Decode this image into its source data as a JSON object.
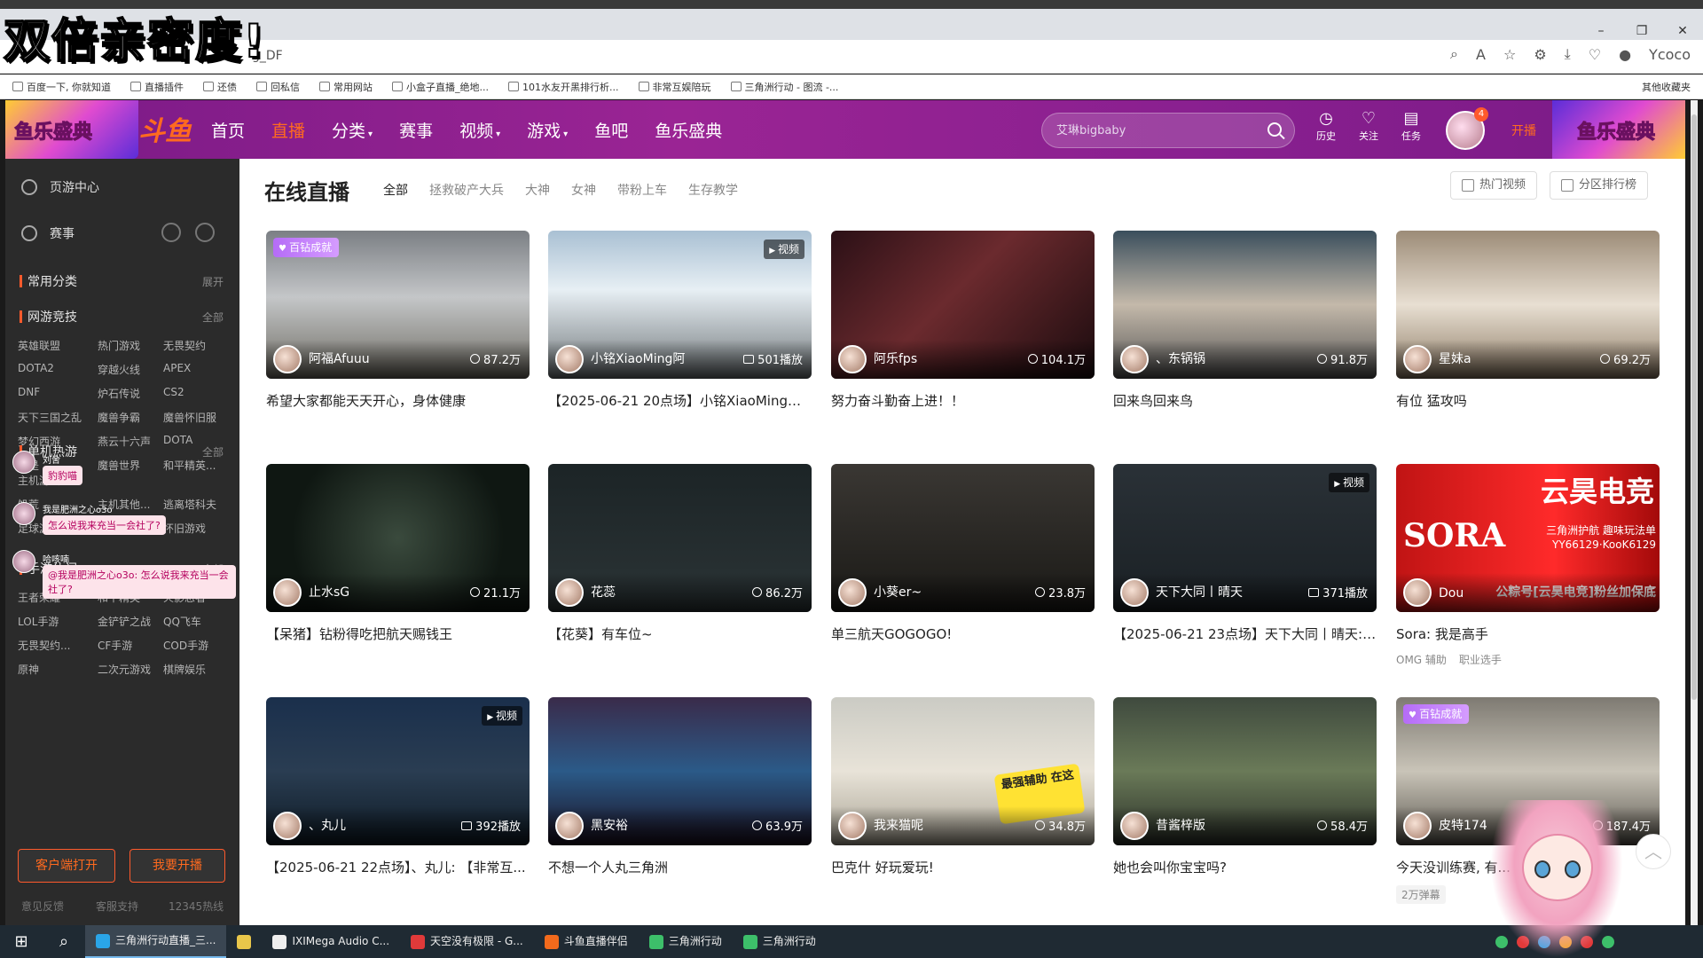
{
  "overlay_title": "双倍亲密度!",
  "browser": {
    "url": "g_DF",
    "bookmarks": [
      "百度一下, 你就知道",
      "直播插件",
      "还债",
      "回私信",
      "常用网站",
      "小盒子直播_绝地...",
      "101水友开黑排行析...",
      "非常互娱陪玩",
      "三角洲行动 - 图流 -..."
    ],
    "other_bookmarks": "其他收藏夹",
    "profile_label": "Ycoco"
  },
  "header": {
    "promo_left": "鱼乐盛典",
    "logo": "斗鱼",
    "nav": [
      {
        "label": "首页",
        "active": false,
        "caret": false
      },
      {
        "label": "直播",
        "active": true,
        "caret": false
      },
      {
        "label": "分类",
        "active": false,
        "caret": true
      },
      {
        "label": "赛事",
        "active": false,
        "caret": false
      },
      {
        "label": "视频",
        "active": false,
        "caret": true
      },
      {
        "label": "游戏",
        "active": false,
        "caret": true
      },
      {
        "label": "鱼吧",
        "active": false,
        "caret": false
      },
      {
        "label": "鱼乐盛典",
        "active": false,
        "caret": false
      }
    ],
    "search_placeholder": "艾琳bigbaby",
    "tools": [
      {
        "label": "历史",
        "icon": "clock-icon"
      },
      {
        "label": "关注",
        "icon": "heart-icon"
      },
      {
        "label": "任务",
        "icon": "task-icon"
      }
    ],
    "avatar_badge": "4",
    "kaibo": "开播",
    "promo_right": "鱼乐盛典"
  },
  "sidebar": {
    "top_items": [
      "页游中心",
      "赛事"
    ],
    "common_label": "常用分类",
    "common_expand": "展开",
    "groups": [
      {
        "label": "网游竞技",
        "expand": "全部",
        "rows": [
          [
            "英雄联盟",
            "热门游戏",
            "无畏契约"
          ],
          [
            "DOTA2",
            "穿越火线",
            "APEX"
          ],
          [
            "DNF",
            "炉石传说",
            "CS2"
          ],
          [
            "天下三国之乱",
            "魔兽争霸",
            "魔兽怀旧服"
          ],
          [
            "梦幻西游",
            "燕云十六声",
            "DOTA"
          ],
          [
            "我是",
            "魔兽世界",
            "和平精英..."
          ]
        ]
      },
      {
        "label": "单机热游",
        "expand": "全部",
        "rows": [
          [
            "主机游戏",
            "",
            ""
          ],
          [
            "饥荒",
            "主机其他...",
            "逃离塔科夫"
          ],
          [
            "足球游戏",
            "格斗游戏",
            "怀旧游戏"
          ]
        ]
      },
      {
        "label": "手游休闲",
        "expand": "全部",
        "rows": [
          [
            "王者荣耀",
            "和平精英",
            "火影忍者"
          ],
          [
            "LOL手游",
            "金铲铲之战",
            "QQ飞车"
          ],
          [
            "无畏契约...",
            "CF手游",
            "COD手游"
          ],
          [
            "原神",
            "二次元游戏",
            "棋牌娱乐"
          ]
        ]
      }
    ],
    "btn_client": "客户端打开",
    "btn_kaibo": "我要开播",
    "footer": [
      "意见反馈",
      "客服支持",
      "12345热线"
    ]
  },
  "chat": [
    {
      "name": "刘舍",
      "bubble": "豹豹喵"
    },
    {
      "name": "我是肥洲之心o3o",
      "bubble": "怎么说我来充当一会社了?"
    },
    {
      "name": "哈咳喃",
      "bubble": "@我是肥洲之心o3o: 怎么说我来充当一会社了?"
    }
  ],
  "main": {
    "title": "在线直播",
    "filters": [
      "全部",
      "拯救破产大兵",
      "大神",
      "女神",
      "带粉上车",
      "生存教学"
    ],
    "right_buttons": [
      "热门视频",
      "分区排行榜"
    ],
    "cards": [
      {
        "name": "阿福Afuuu",
        "viewers": "87.2万",
        "type": "hot",
        "title": "希望大家都能天天开心，身体健康",
        "badge": "百钻成就",
        "video": "",
        "tags": []
      },
      {
        "name": "小铭XiaoMing阿",
        "viewers": "501播放",
        "type": "play",
        "title": "【2025-06-21 20点场】小铭XiaoMing阿: ...",
        "badge": "",
        "video": "视频",
        "tags": []
      },
      {
        "name": "阿乐fps",
        "viewers": "104.1万",
        "type": "hot",
        "title": "努力奋斗勤奋上进！！",
        "badge": "",
        "video": "",
        "tags": []
      },
      {
        "name": "、东锅锅",
        "viewers": "91.8万",
        "type": "hot",
        "title": "回来鸟回来鸟",
        "badge": "",
        "video": "",
        "tags": []
      },
      {
        "name": "星妹a",
        "viewers": "69.2万",
        "type": "hot",
        "title": "有位 猛攻吗",
        "badge": "",
        "video": "",
        "tags": []
      },
      {
        "name": "止水sG",
        "viewers": "21.1万",
        "type": "hot",
        "title": "【呆猪】钻粉得吃把航天赐钱王",
        "badge": "",
        "video": "",
        "tags": []
      },
      {
        "name": "花蕊",
        "viewers": "86.2万",
        "type": "hot",
        "title": "【花葵】有车位~",
        "badge": "",
        "video": "",
        "tags": []
      },
      {
        "name": "小葵er~",
        "viewers": "23.8万",
        "type": "hot",
        "title": "单三航天GOGOGO!",
        "badge": "",
        "video": "",
        "tags": []
      },
      {
        "name": "天下大同丨晴天",
        "viewers": "371播放",
        "type": "play",
        "title": "【2025-06-21 23点场】天下大同丨晴天: ...",
        "badge": "",
        "video": "视频",
        "tags": []
      },
      {
        "name": "Dou",
        "viewers": "",
        "type": "hot",
        "title": "Sora: 我是高手",
        "badge": "",
        "video": "",
        "tags": [
          "OMG 辅助",
          "职业选手"
        ]
      },
      {
        "name": "、丸儿",
        "viewers": "392播放",
        "type": "play",
        "title": "【2025-06-21 22点场】、丸儿: 【非常互...",
        "badge": "",
        "video": "视频",
        "tags": []
      },
      {
        "name": "黑安裕",
        "viewers": "63.9万",
        "type": "hot",
        "title": "不想一个人丸三角洲",
        "badge": "",
        "video": "",
        "tags": []
      },
      {
        "name": "我来猫呢",
        "viewers": "34.8万",
        "type": "hot",
        "title": "巴克什 好玩爱玩!",
        "badge": "",
        "video": "",
        "tags": []
      },
      {
        "name": "昔酱梓版",
        "viewers": "58.4万",
        "type": "hot",
        "title": "她也会叫你宝宝吗?",
        "badge": "",
        "video": "",
        "tags": []
      },
      {
        "name": "皮特174",
        "viewers": "187.4万",
        "type": "hot",
        "title": "今天没训练赛, 有...",
        "badge": "百钻成就",
        "video": "",
        "tags": [
          "2万弹幕"
        ]
      }
    ],
    "promo_card": {
      "brand": "云昊电竞",
      "big": "SORA",
      "line1": "三角洲护航 趣味玩法单",
      "line2": "YY66129·KooK6129",
      "line3": "公粽号[云昊电竞]粉丝加保底"
    },
    "sticker_text": "最强辅助 在这"
  },
  "taskbar": {
    "items": [
      "三角洲行动直播_三...",
      "",
      "IXIMega Audio C...",
      "天空没有极限 - G...",
      "斗鱼直播伴侣",
      "三角洲行动",
      "三角洲行动"
    ]
  }
}
